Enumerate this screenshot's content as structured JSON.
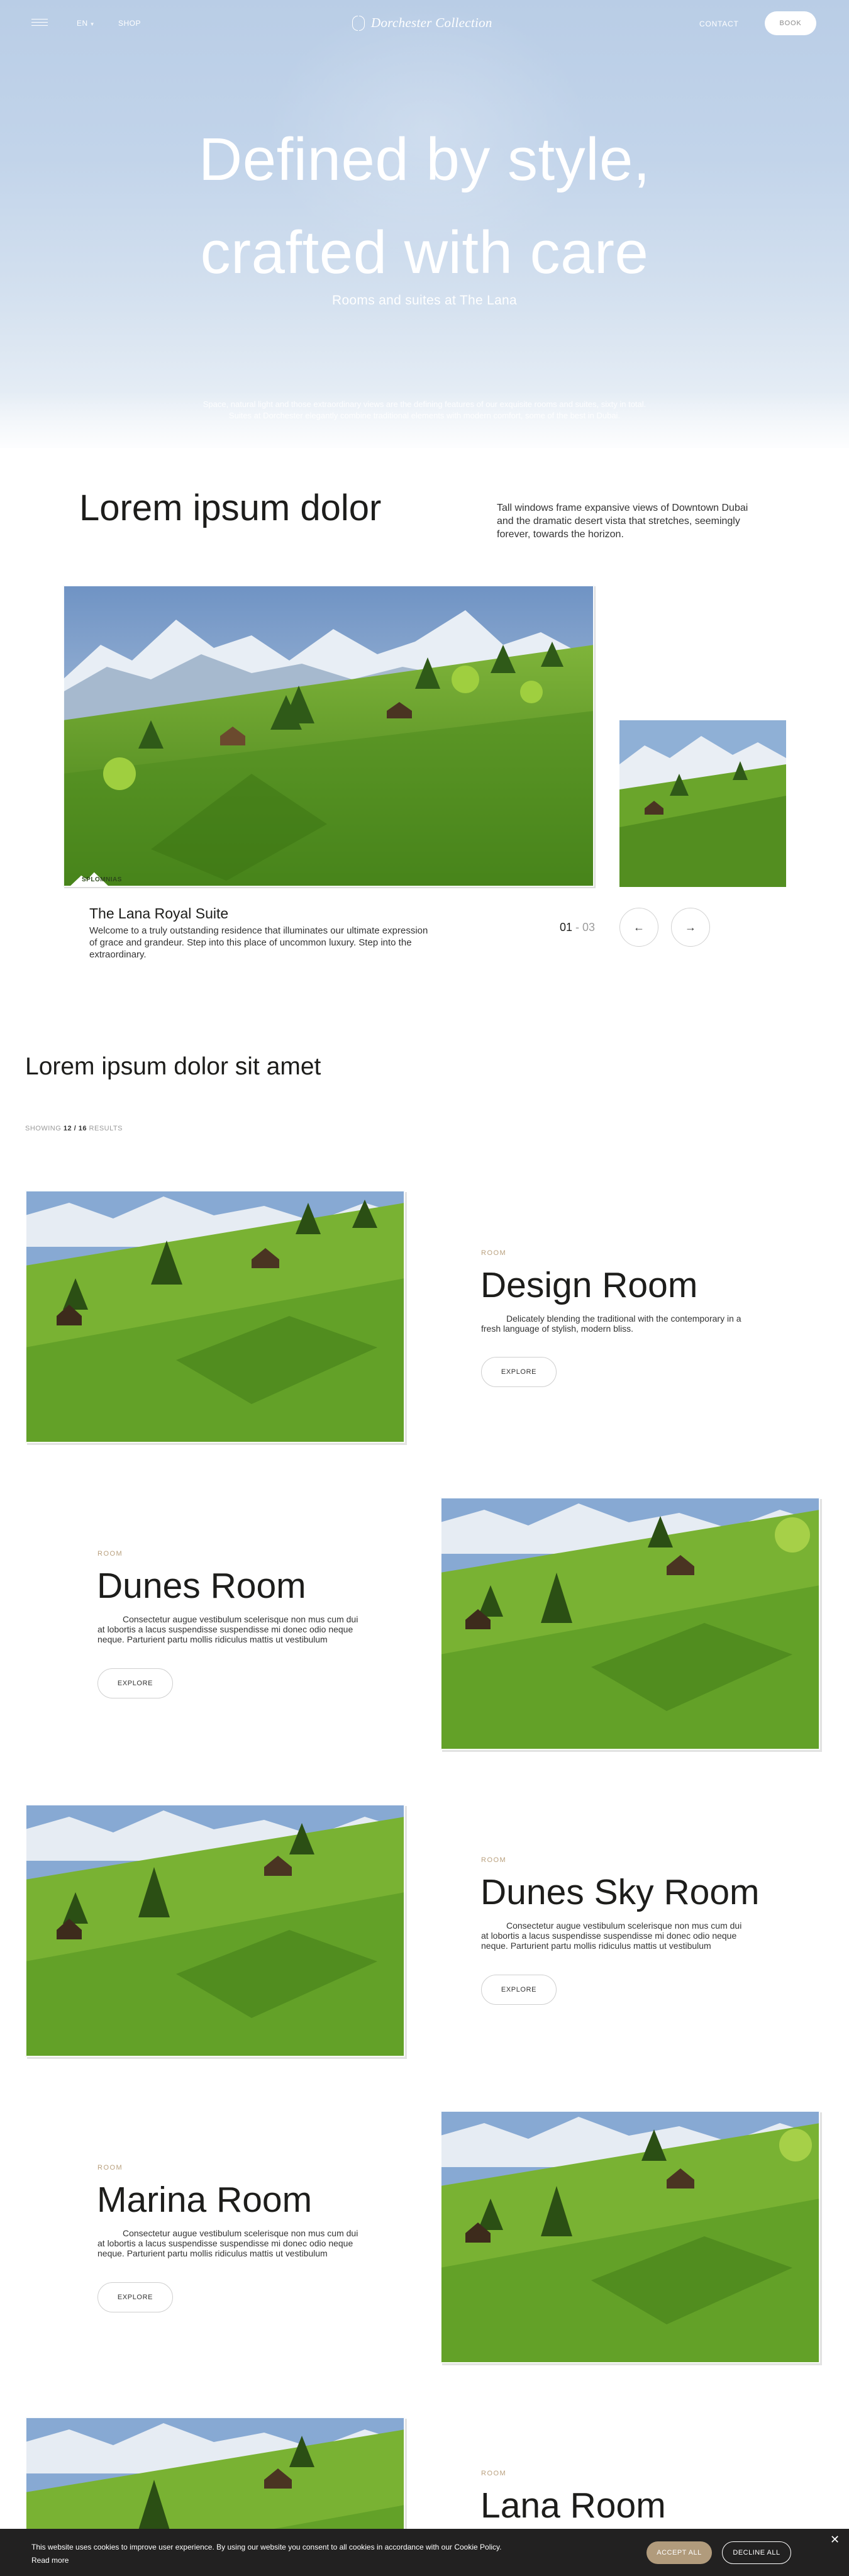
{
  "header": {
    "lang_label": "EN",
    "shop_label": "SHOP",
    "logo_text": "Dorchester Collection",
    "contact_label": "CONTACT",
    "book_label": "BOOK",
    "icons": {
      "menu": "hamburger-menu-icon",
      "lang": "chevron-down-icon",
      "logo": "dorchester-mark-icon"
    }
  },
  "hero": {
    "title_line1": "Defined by style,",
    "title_line2": "crafted with care",
    "subtitle": "Rooms and suites at The Lana",
    "description_line1": "Space, natural light and those extraordinary views are the defining features of our exquisite rooms and suites, sixty in total.",
    "description_line2": "Suites at Dorchester elegantly combine traditional elements with modern comfort, some of the best in Dubai."
  },
  "intro": {
    "title": "Lorem ipsum dolor",
    "text": "Tall windows frame expansive views of Downtown Dubai and the dramatic desert vista that stretches, seemingly forever, towards the horizon."
  },
  "feature": {
    "watermark": "SPLOMNIAS",
    "suite_name": "The Lana Royal Suite",
    "suite_text": "Welcome to a truly outstanding residence that illuminates our ultimate expression of grace and grandeur. Step into this place of uncommon luxury. Step into the extraordinary.",
    "counter_current": "01",
    "counter_sep": " - ",
    "counter_total": "03",
    "icons": {
      "prev": "arrow-left-icon",
      "next": "arrow-right-icon"
    }
  },
  "listing": {
    "title": "Lorem ipsum dolor sit amet",
    "showing_prefix": "SHOWING",
    "showing_count": "12 / 16",
    "showing_suffix": "RESULTS",
    "rooms": [
      {
        "label": "ROOM",
        "name": "Design Room",
        "description": "Delicately blending the traditional with the contemporary in a fresh language of stylish, modern bliss.",
        "cta": "EXPLORE"
      },
      {
        "label": "ROOM",
        "name": "Dunes Room",
        "description": "Consectetur augue vestibulum scelerisque non mus cum dui at lobortis a lacus suspendisse suspendisse mi donec odio neque neque. Parturient partu mollis ridiculus mattis ut vestibulum",
        "cta": "EXPLORE"
      },
      {
        "label": "ROOM",
        "name": "Dunes Sky Room",
        "description": "Consectetur augue vestibulum scelerisque non mus cum dui at lobortis a lacus suspendisse suspendisse mi donec odio neque neque. Parturient partu mollis ridiculus mattis ut vestibulum",
        "cta": "EXPLORE"
      },
      {
        "label": "ROOM",
        "name": "Marina Room",
        "description": "Consectetur augue vestibulum scelerisque non mus cum dui at lobortis a lacus suspendisse suspendisse mi donec odio neque neque. Parturient partu mollis ridiculus mattis ut vestibulum",
        "cta": "EXPLORE"
      },
      {
        "label": "ROOM",
        "name": "Lana Room",
        "description": "",
        "cta": ""
      }
    ]
  },
  "cookie": {
    "text": "This website uses cookies to improve user experience. By using our website you consent to all cookies in accordance with our Cookie Policy.",
    "read_more": "Read more",
    "accept_label": "ACCEPT ALL",
    "decline_label": "DECLINE ALL",
    "close_icon": "close-icon"
  },
  "colors": {
    "hero_sky": "#bfd2e8",
    "gold_accent": "#b9a07e",
    "accept_button": "#b19b7c",
    "cookie_bar": "#222121",
    "grass": "#5f9b2a"
  }
}
